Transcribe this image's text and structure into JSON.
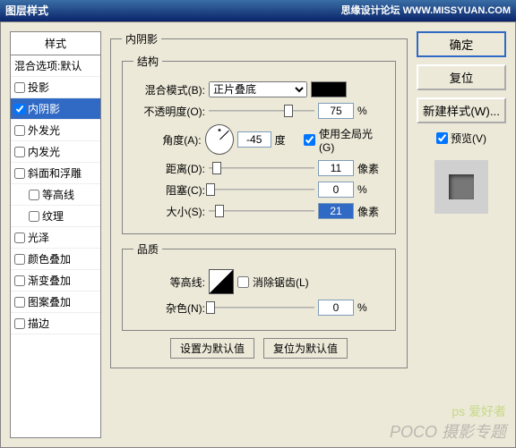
{
  "title": "图层样式",
  "titleRight": "思缘设计论坛  WWW.MISSYUAN.COM",
  "left": {
    "head": "样式",
    "heading2": "混合选项:默认",
    "items": [
      {
        "label": "投影",
        "chk": false,
        "sel": false
      },
      {
        "label": "内阴影",
        "chk": true,
        "sel": true
      },
      {
        "label": "外发光",
        "chk": false,
        "sel": false
      },
      {
        "label": "内发光",
        "chk": false,
        "sel": false
      },
      {
        "label": "斜面和浮雕",
        "chk": false,
        "sel": false
      },
      {
        "label": "等高线",
        "chk": false,
        "sel": false,
        "indent": true
      },
      {
        "label": "纹理",
        "chk": false,
        "sel": false,
        "indent": true
      },
      {
        "label": "光泽",
        "chk": false,
        "sel": false
      },
      {
        "label": "颜色叠加",
        "chk": false,
        "sel": false
      },
      {
        "label": "渐变叠加",
        "chk": false,
        "sel": false
      },
      {
        "label": "图案叠加",
        "chk": false,
        "sel": false
      },
      {
        "label": "描边",
        "chk": false,
        "sel": false
      }
    ]
  },
  "mid": {
    "title": "内阴影",
    "fs1": "结构",
    "fs2": "品质",
    "blendLabel": "混合模式(B):",
    "blendValue": "正片叠底",
    "opacityLabel": "不透明度(O):",
    "opacityVal": "75",
    "opacityUnit": "%",
    "opacityPos": 75,
    "angleLabel": "角度(A):",
    "angleVal": "-45",
    "angleUnit": "度",
    "globalLight": "使用全局光(G)",
    "distLabel": "距离(D):",
    "distVal": "11",
    "distUnit": "像素",
    "distPos": 8,
    "chokeLabel": "阻塞(C):",
    "chokeVal": "0",
    "chokeUnit": "%",
    "chokePos": 2,
    "sizeLabel": "大小(S):",
    "sizeVal": "21",
    "sizeUnit": "像素",
    "sizePos": 10,
    "contourLabel": "等高线:",
    "antiAlias": "消除锯齿(L)",
    "noiseLabel": "杂色(N):",
    "noiseVal": "0",
    "noiseUnit": "%",
    "noisePos": 2,
    "defBtn": "设置为默认值",
    "resetBtn": "复位为默认值"
  },
  "right": {
    "ok": "确定",
    "reset": "复位",
    "newStyle": "新建样式(W)...",
    "preview": "预览(V)"
  },
  "wm1": "POCO 摄影专题",
  "wm2": "ps 爱好者"
}
